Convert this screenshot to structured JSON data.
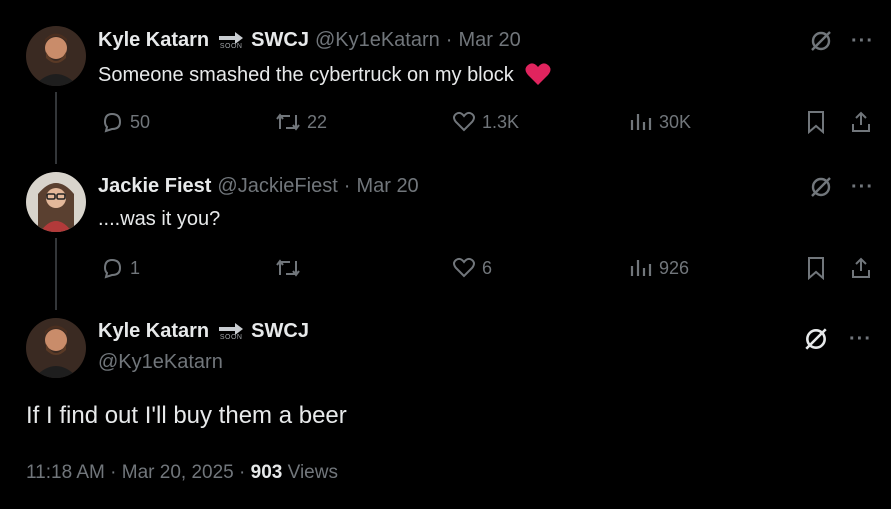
{
  "thread": [
    {
      "author_name": "Kyle Katarn",
      "author_suffix": "SWCJ",
      "soon_badge": "SOON",
      "handle": "@Ky1eKatarn",
      "date": "Mar 20",
      "text": "Someone smashed the cybertruck on my block",
      "emoji": "heart",
      "replies": "50",
      "reposts": "22",
      "likes": "1.3K",
      "views": "30K"
    },
    {
      "author_name": "Jackie Fiest",
      "handle": "@JackieFiest",
      "date": "Mar 20",
      "text": "....was it you?",
      "replies": "1",
      "reposts": "",
      "likes": "6",
      "views": "926"
    }
  ],
  "main": {
    "author_name": "Kyle Katarn",
    "author_suffix": "SWCJ",
    "soon_badge": "SOON",
    "handle": "@Ky1eKatarn",
    "text": "If I find out I'll buy them a beer",
    "time": "11:18 AM",
    "date": "Mar 20, 2025",
    "views_count": "903",
    "views_label": "Views"
  },
  "separator": "·",
  "more_label": "···",
  "icons": [
    "grok-icon",
    "more-icon",
    "reply-icon",
    "repost-icon",
    "like-icon",
    "views-icon",
    "bookmark-icon",
    "share-icon",
    "heart-emoji",
    "arrow-icon"
  ],
  "colors": {
    "background": "#000000",
    "text": "#e7e9ea",
    "muted": "#71767b",
    "heart": "#f91880",
    "line": "#333639"
  }
}
